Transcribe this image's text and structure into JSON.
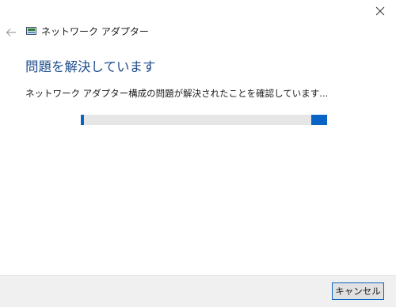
{
  "window": {
    "title": "ネットワーク アダプター",
    "close_icon": "close-icon",
    "back_icon": "back-arrow-icon",
    "app_icon": "network-adapter-icon"
  },
  "main": {
    "heading": "問題を解決しています",
    "status": "ネットワーク アダプター構成の問題が解決されたことを確認しています...",
    "progress": {
      "state": "indeterminate"
    }
  },
  "footer": {
    "cancel_label": "キャンセル"
  },
  "colors": {
    "accent": "#0a64c4",
    "heading": "#1f4e8c",
    "track": "#e6e6e6",
    "footer_bg": "#f0f0f0"
  }
}
